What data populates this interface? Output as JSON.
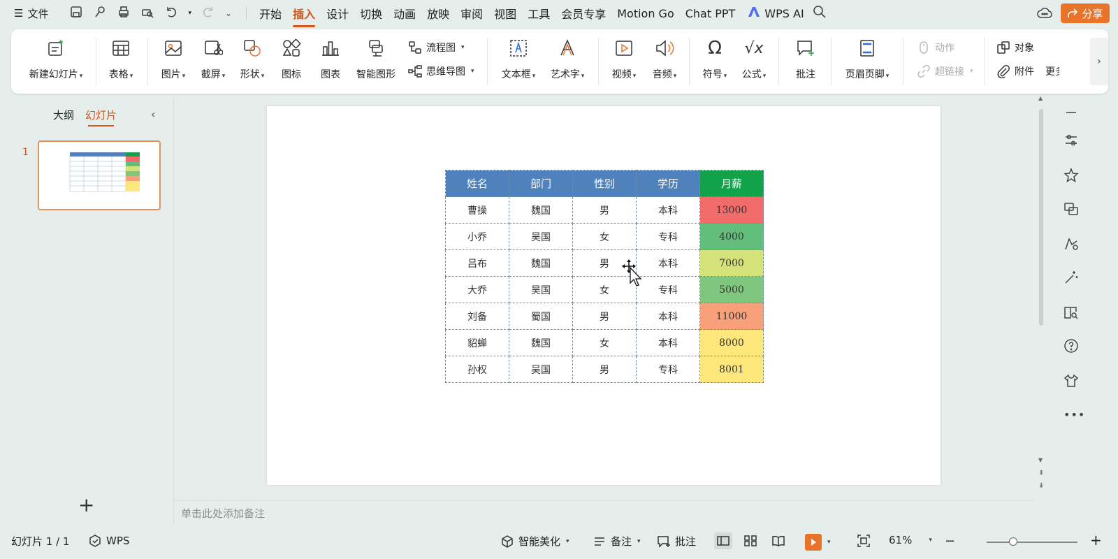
{
  "menu": {
    "file_label": "文件",
    "tabs": [
      "开始",
      "插入",
      "设计",
      "切换",
      "动画",
      "放映",
      "审阅",
      "视图",
      "工具",
      "会员专享",
      "Motion Go",
      "Chat PPT"
    ],
    "active_tab": "插入",
    "wps_ai_label": "WPS AI",
    "share_label": "分享",
    "share_color": "#e8742c",
    "accent_color": "#d4561c"
  },
  "ribbon": {
    "new_slide": "新建幻灯片",
    "table": "表格",
    "picture": "图片",
    "screenshot": "截屏",
    "shape": "形状",
    "icons": "图标",
    "chart": "图表",
    "smart_graphic": "智能图形",
    "flowchart": "流程图",
    "mindmap": "思维导图",
    "textbox": "文本框",
    "wordart": "艺术字",
    "video": "视频",
    "audio": "音频",
    "symbol": "符号",
    "formula": "公式",
    "comment": "批注",
    "header_footer": "页眉页脚",
    "action": "动作",
    "hyperlink": "超链接",
    "object": "对象",
    "attachment": "附件",
    "more": "更多"
  },
  "left_panel": {
    "outline_tab": "大纲",
    "slides_tab": "幻灯片",
    "slide_number": "1",
    "add_label": "+"
  },
  "slide_table": {
    "headers": [
      "姓名",
      "部门",
      "性别",
      "学历",
      "月薪"
    ],
    "rows": [
      [
        "曹操",
        "魏国",
        "男",
        "本科",
        "13000"
      ],
      [
        "小乔",
        "吴国",
        "女",
        "专科",
        "4000"
      ],
      [
        "吕布",
        "魏国",
        "男",
        "本科",
        "7000"
      ],
      [
        "大乔",
        "吴国",
        "女",
        "专科",
        "5000"
      ],
      [
        "刘备",
        "蜀国",
        "男",
        "本科",
        "11000"
      ],
      [
        "貂蝉",
        "魏国",
        "女",
        "本科",
        "8000"
      ],
      [
        "孙权",
        "吴国",
        "男",
        "专科",
        "8001"
      ]
    ],
    "salary_colors": [
      "#f26b6b",
      "#63be7b",
      "#d4e27a",
      "#7fc77e",
      "#f8a07a",
      "#fde67a",
      "#fde67a"
    ],
    "header_color": "#4f81bd",
    "salary_header_color": "#12a34a"
  },
  "notes": {
    "placeholder": "单击此处添加备注"
  },
  "status": {
    "slide_counter": "幻灯片 1 / 1",
    "wps_label": "WPS",
    "beautify": "智能美化",
    "notes": "备注",
    "comments": "批注",
    "zoom": "61%"
  }
}
